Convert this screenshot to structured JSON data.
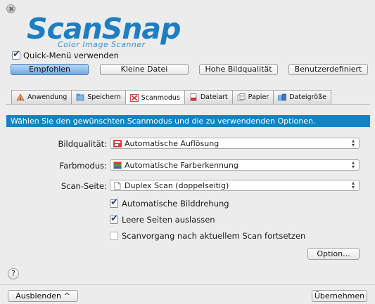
{
  "logo": {
    "word": "ScanSnap",
    "subtitle": "Color Image Scanner"
  },
  "quick_menu": {
    "label": "Quick-Menü verwenden",
    "checked": true
  },
  "presets": [
    {
      "label": "Empfohlen",
      "active": true
    },
    {
      "label": "Kleine Datei",
      "active": false
    },
    {
      "label": "Hohe Bildqualität",
      "active": false
    },
    {
      "label": "Benutzerdefiniert",
      "active": false
    }
  ],
  "tabs": [
    {
      "label": "Anwendung",
      "icon": "application-icon"
    },
    {
      "label": "Speichern",
      "icon": "save-folder-icon"
    },
    {
      "label": "Scanmodus",
      "icon": "scan-mode-icon",
      "active": true
    },
    {
      "label": "Dateiart",
      "icon": "file-type-icon"
    },
    {
      "label": "Papier",
      "icon": "paper-icon"
    },
    {
      "label": "Dateigröße",
      "icon": "file-size-icon"
    }
  ],
  "banner": "Wählen Sie den gewünschten Scanmodus und die zu verwendenden Optionen.",
  "fields": {
    "quality": {
      "label": "Bildqualität:",
      "value": "Automatische Auflösung",
      "icon": "resolution-icon"
    },
    "color": {
      "label": "Farbmodus:",
      "value": "Automatische Farberkennung",
      "icon": "color-detect-icon"
    },
    "side": {
      "label": "Scan-Seite:",
      "value": "Duplex Scan (doppelseitig)",
      "icon": "page-icon"
    }
  },
  "options": [
    {
      "label": "Automatische Bilddrehung",
      "checked": true
    },
    {
      "label": "Leere Seiten auslassen",
      "checked": true
    },
    {
      "label": "Scanvorgang nach aktuellem Scan fortsetzen",
      "checked": false
    }
  ],
  "buttons": {
    "option": "Option...",
    "help": "?",
    "hide": "Ausblenden ^",
    "apply": "Übernehmen"
  },
  "colors": {
    "accent": "#0f85c7",
    "logo": "#1f7ec2",
    "active_preset": "#6fa8e2"
  }
}
